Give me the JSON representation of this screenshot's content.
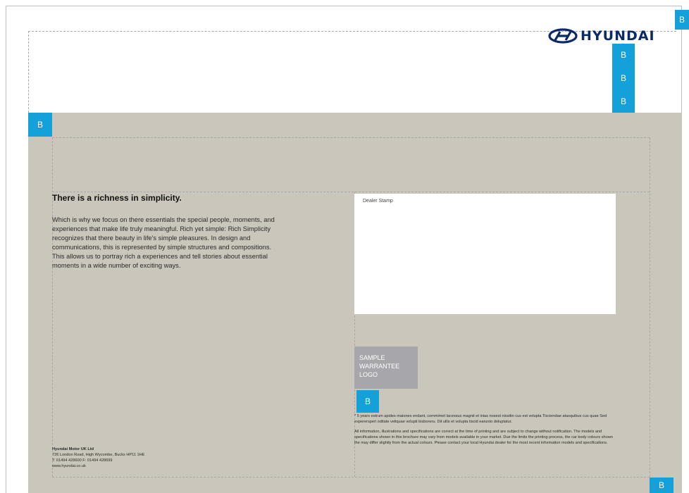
{
  "brand": {
    "logo_text": "HYUNDAI"
  },
  "badges": {
    "label": "B"
  },
  "content": {
    "headline": "There is a richness in simplicity.",
    "body": "Which is why we focus on there essentials the special people, moments, and experiences that make life truly meaningful. Rich yet simple: Rich Simplicity recognizes that there beauty in life's simple pleasures. In design and communications, this is represented by simple structures and compositions. This allows us to portray rich a experiences and tell stories about essential moments in a wide number of exciting ways."
  },
  "dealer_stamp": {
    "label": "Dealer Stamp"
  },
  "warrantee_logo": {
    "line1": "SAMPLE",
    "line2": "WARRANTEE",
    "line3": "LOGO"
  },
  "legal": {
    "footnote": "* 5 years estrum apides maiones endant, commimet lacessus magnit et inias nosest nissitin cus est volupta Tisciendae atasquibus cus quae Sed experersperi oditate veliquae volupti bisboreru. Dit ullis et volupta tiscid earunto doluptatur.",
    "disclaimer": "All information, illustrations and specifications are correct at the time of printing and are subject to change without notification. The models and specifications shown in this brochure may vary from models available in your market. Due the limits the printing process, the car body colours shown the may differ slightly from the actual colours. Please contact your local Hyundai dealer for the most recent information models and specifications."
  },
  "address": {
    "company": "Hyundai Motor UK Ltd",
    "street": "726 London Road, High Wycombe, Bucks HP11 1HE",
    "phone": "T: 01494 428600 F: 01494 428699",
    "web": "www.hyundai.co.uk"
  },
  "colors": {
    "band": "#cbc6bb",
    "badge": "#14a0d9",
    "logo": "#0b2a66",
    "warrantee_box": "#a7a6ab"
  }
}
